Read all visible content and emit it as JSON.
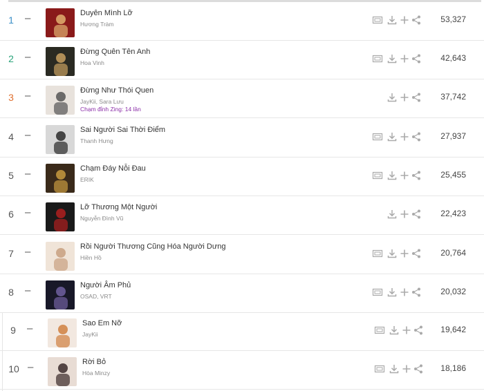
{
  "colors": {
    "rank1": "#3a8fc8",
    "rank2": "#2aa37a",
    "rank3": "#e07030",
    "rank_other": "#555555",
    "badge": "#8b2fa8"
  },
  "icons": [
    "mv-icon",
    "download-icon",
    "add-icon",
    "share-icon"
  ],
  "songs": [
    {
      "rank": "1",
      "trend": "–",
      "title": "Duyên Mình Lỡ",
      "artist": "Hương Tràm",
      "badge": "",
      "mv": true,
      "count": "53,327"
    },
    {
      "rank": "2",
      "trend": "–",
      "title": "Đừng Quên Tên Anh",
      "artist": "Hoa Vinh",
      "badge": "",
      "mv": true,
      "count": "42,643"
    },
    {
      "rank": "3",
      "trend": "–",
      "title": "Đừng Như Thói Quen",
      "artist": "JayKii, Sara Lưu",
      "badge": "Chạm đỉnh Zing: 14 lần",
      "mv": false,
      "count": "37,742"
    },
    {
      "rank": "4",
      "trend": "–",
      "title": "Sai Người Sai Thời Điểm",
      "artist": "Thanh Hưng",
      "badge": "",
      "mv": true,
      "count": "27,937"
    },
    {
      "rank": "5",
      "trend": "–",
      "title": "Chạm Đáy Nỗi Đau",
      "artist": "ERIK",
      "badge": "",
      "mv": true,
      "count": "25,455"
    },
    {
      "rank": "6",
      "trend": "–",
      "title": "Lỡ Thương Một Người",
      "artist": "Nguyễn Đình Vũ",
      "badge": "",
      "mv": false,
      "count": "22,423"
    },
    {
      "rank": "7",
      "trend": "–",
      "title": "Rồi Người Thương Cũng Hóa Người Dưng",
      "artist": "Hiền Hồ",
      "badge": "",
      "mv": true,
      "count": "20,764"
    },
    {
      "rank": "8",
      "trend": "–",
      "title": "Người Âm Phủ",
      "artist": "OSAD, VRT",
      "badge": "",
      "mv": true,
      "count": "20,032"
    },
    {
      "rank": "9",
      "trend": "–",
      "title": "Sao Em Nỡ",
      "artist": "JayKii",
      "badge": "",
      "mv": true,
      "count": "19,642"
    },
    {
      "rank": "10",
      "trend": "–",
      "title": "Rời Bỏ",
      "artist": "Hòa Minzy",
      "badge": "",
      "mv": true,
      "count": "18,186"
    }
  ]
}
